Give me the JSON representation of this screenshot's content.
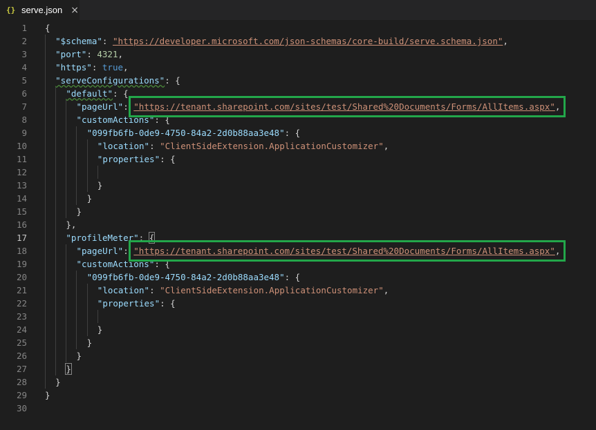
{
  "tab": {
    "icon": "{}",
    "title": "serve.json",
    "close": "×"
  },
  "editor": {
    "active_line": 17
  },
  "lines": [
    [
      [
        "p",
        "{"
      ]
    ],
    [
      [
        "k",
        "\"$schema\""
      ],
      [
        "p",
        ": "
      ],
      [
        "su",
        "\"https://developer.microsoft.com/json-schemas/core-build/serve.schema.json\""
      ],
      [
        "p",
        ","
      ]
    ],
    [
      [
        "k",
        "\"port\""
      ],
      [
        "p",
        ": "
      ],
      [
        "n",
        "4321"
      ],
      [
        "p",
        ","
      ]
    ],
    [
      [
        "k",
        "\"https\""
      ],
      [
        "p",
        ": "
      ],
      [
        "b",
        "true"
      ],
      [
        "p",
        ","
      ]
    ],
    [
      [
        "kq",
        "\"serveConfigurations\""
      ],
      [
        "p",
        ": {"
      ]
    ],
    [
      [
        "kq",
        "\"default\""
      ],
      [
        "p",
        ": {"
      ]
    ],
    [
      [
        "k",
        "\"pageUrl\""
      ],
      [
        "p",
        ": "
      ],
      [
        "su",
        "\"https://tenant.sharepoint.com/sites/test/Shared%20Documents/Forms/AllItems.aspx\""
      ],
      [
        "p",
        ","
      ]
    ],
    [
      [
        "k",
        "\"customActions\""
      ],
      [
        "p",
        ": {"
      ]
    ],
    [
      [
        "k",
        "\"099fb6fb-0de9-4750-84a2-2d0b88aa3e48\""
      ],
      [
        "p",
        ": {"
      ]
    ],
    [
      [
        "k",
        "\"location\""
      ],
      [
        "p",
        ": "
      ],
      [
        "s",
        "\"ClientSideExtension.ApplicationCustomizer\""
      ],
      [
        "p",
        ","
      ]
    ],
    [
      [
        "k",
        "\"properties\""
      ],
      [
        "p",
        ": {"
      ]
    ],
    [],
    [
      [
        "p",
        "}"
      ]
    ],
    [
      [
        "p",
        "}"
      ]
    ],
    [
      [
        "p",
        "}"
      ]
    ],
    [
      [
        "p",
        "},"
      ]
    ],
    [
      [
        "k",
        "\"profileMeter\""
      ],
      [
        "p",
        ": "
      ],
      [
        "bm",
        "{"
      ]
    ],
    [
      [
        "k",
        "\"pageUrl\""
      ],
      [
        "p",
        ": "
      ],
      [
        "su",
        "\"https://tenant.sharepoint.com/sites/test/Shared%20Documents/Forms/AllItems.aspx\""
      ],
      [
        "p",
        ","
      ]
    ],
    [
      [
        "k",
        "\"customActions\""
      ],
      [
        "p",
        ": {"
      ]
    ],
    [
      [
        "k",
        "\"099fb6fb-0de9-4750-84a2-2d0b88aa3e48\""
      ],
      [
        "p",
        ": {"
      ]
    ],
    [
      [
        "k",
        "\"location\""
      ],
      [
        "p",
        ": "
      ],
      [
        "s",
        "\"ClientSideExtension.ApplicationCustomizer\""
      ],
      [
        "p",
        ","
      ]
    ],
    [
      [
        "k",
        "\"properties\""
      ],
      [
        "p",
        ": {"
      ]
    ],
    [],
    [
      [
        "p",
        "}"
      ]
    ],
    [
      [
        "p",
        "}"
      ]
    ],
    [
      [
        "p",
        "}"
      ]
    ],
    [
      [
        "bm",
        "}"
      ]
    ],
    [
      [
        "p",
        "}"
      ]
    ],
    [
      [
        "p",
        "}"
      ]
    ],
    []
  ],
  "highlight_boxes": [
    {
      "label": "default-pageurl-highlight",
      "line": 7
    },
    {
      "label": "profilemeter-pageurl-highlight",
      "line": 18
    }
  ],
  "colors": {
    "background": "#1e1e1e",
    "key": "#9cdcfe",
    "string": "#ce9178",
    "number": "#b5cea8",
    "boolean": "#569cd6",
    "highlight_box": "#23a74a"
  }
}
